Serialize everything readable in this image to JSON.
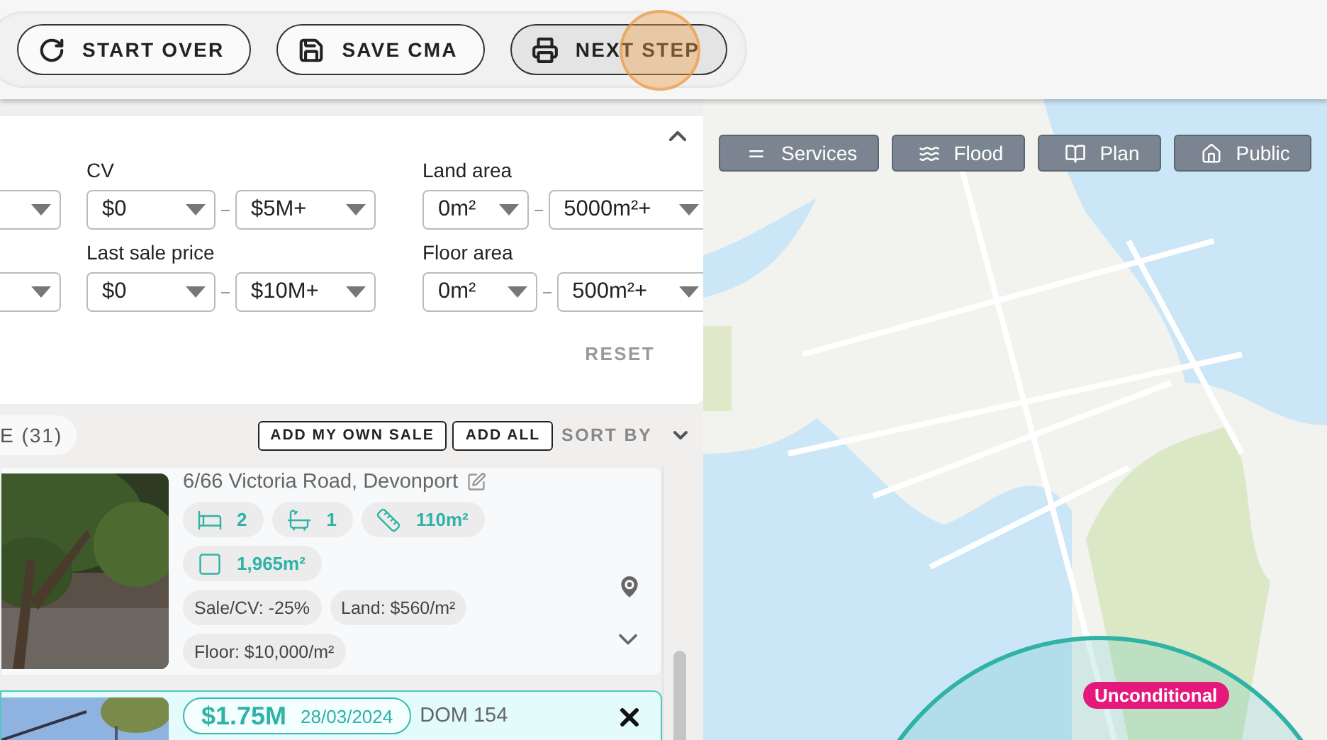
{
  "toolbar": {
    "buttons": [
      {
        "label": "START OVER",
        "selected": false
      },
      {
        "label": "SAVE CMA",
        "selected": false
      },
      {
        "label": "NEXT STEP",
        "selected": true
      }
    ]
  },
  "filters": {
    "fields": [
      {
        "label": "CV",
        "min": "$0",
        "max": "$5M+"
      },
      {
        "label": "Land area",
        "min": "0m²",
        "max": "5000m²+"
      },
      {
        "label": "Last sale price",
        "min": "$0",
        "max": "$10M+"
      },
      {
        "label": "Floor area",
        "min": "0m²",
        "max": "500m²+"
      }
    ],
    "reset": "RESET"
  },
  "list_bar": {
    "tab": "E (31)",
    "buttons": [
      "ADD MY OWN SALE",
      "ADD ALL"
    ],
    "sort": "SORT BY"
  },
  "sales": [
    {
      "address": "6/66 Victoria Road, Devonport",
      "selected": false,
      "features": [
        {
          "kind": "bed",
          "value": "2"
        },
        {
          "kind": "bath",
          "value": "1"
        },
        {
          "kind": "floor",
          "value": "110m²"
        },
        {
          "kind": "land",
          "value": "1,965m²"
        }
      ],
      "stats": [
        "Sale/CV: -25%",
        "Land: $560/m²",
        "Floor: $10,000/m²"
      ]
    },
    {
      "price": "$1.75M",
      "date": "28/03/2024",
      "dom": "DOM 154",
      "selected": true
    }
  ],
  "map": {
    "layers": [
      {
        "label": "Services"
      },
      {
        "label": "Flood"
      },
      {
        "label": "Plan"
      },
      {
        "label": "Public"
      }
    ],
    "badge": "Unconditional"
  }
}
